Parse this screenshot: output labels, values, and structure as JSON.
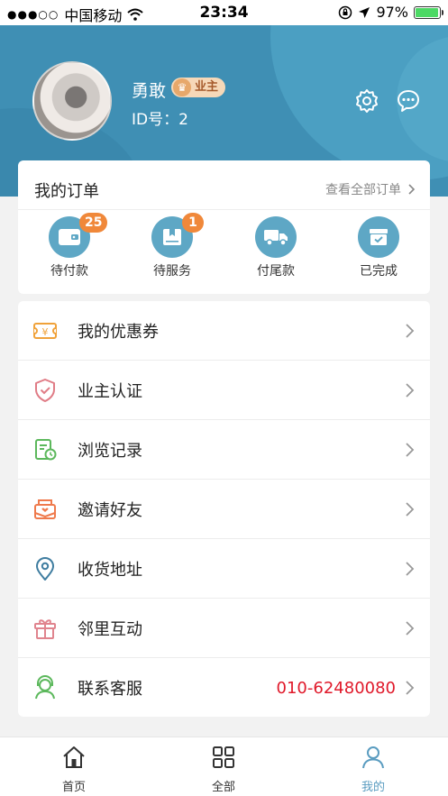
{
  "status_bar": {
    "signal_dots": "●●●○○",
    "carrier": "中国移动",
    "time": "23:34",
    "battery_percent": "97%",
    "battery_level": 0.97
  },
  "profile": {
    "name": "勇敢",
    "badge": "业主",
    "id_label": "ID号：",
    "id_value": "2"
  },
  "header_icons": [
    "settings-gear-icon",
    "message-icon"
  ],
  "orders": {
    "title": "我的订单",
    "view_all": "查看全部订单",
    "items": [
      {
        "label": "待付款",
        "count": "25",
        "icon": "wallet-icon"
      },
      {
        "label": "待服务",
        "count": "1",
        "icon": "booklet-icon"
      },
      {
        "label": "付尾款",
        "count": null,
        "icon": "truck-icon"
      },
      {
        "label": "已完成",
        "count": null,
        "icon": "completed-box-icon"
      }
    ]
  },
  "menu": [
    {
      "label": "我的优惠券",
      "icon": "coupon-icon",
      "color": "#f0a23a",
      "value": ""
    },
    {
      "label": "业主认证",
      "icon": "shield-check-icon",
      "color": "#e07c86",
      "value": ""
    },
    {
      "label": "浏览记录",
      "icon": "history-document-icon",
      "color": "#5cb85c",
      "value": ""
    },
    {
      "label": "邀请好友",
      "icon": "invite-envelope-icon",
      "color": "#ef7a4c",
      "value": ""
    },
    {
      "label": "收货地址",
      "icon": "location-pin-icon",
      "color": "#3f7da0",
      "value": ""
    },
    {
      "label": "邻里互动",
      "icon": "gift-icon",
      "color": "#e0848e",
      "value": ""
    },
    {
      "label": "联系客服",
      "icon": "customer-service-icon",
      "color": "#5cb85c",
      "value": "010-62480080"
    }
  ],
  "tabbar": {
    "tabs": [
      {
        "label": "首页",
        "icon": "home-icon",
        "active": false
      },
      {
        "label": "全部",
        "icon": "grid-icon",
        "active": false
      },
      {
        "label": "我的",
        "icon": "profile-icon",
        "active": true
      }
    ]
  },
  "colors": {
    "header_bg": "#3f8fb4",
    "order_icon_bg": "#5ea7c5",
    "badge_orange": "#f0883a",
    "phone_red": "#e0192a",
    "active_tab": "#5a9cc0"
  }
}
